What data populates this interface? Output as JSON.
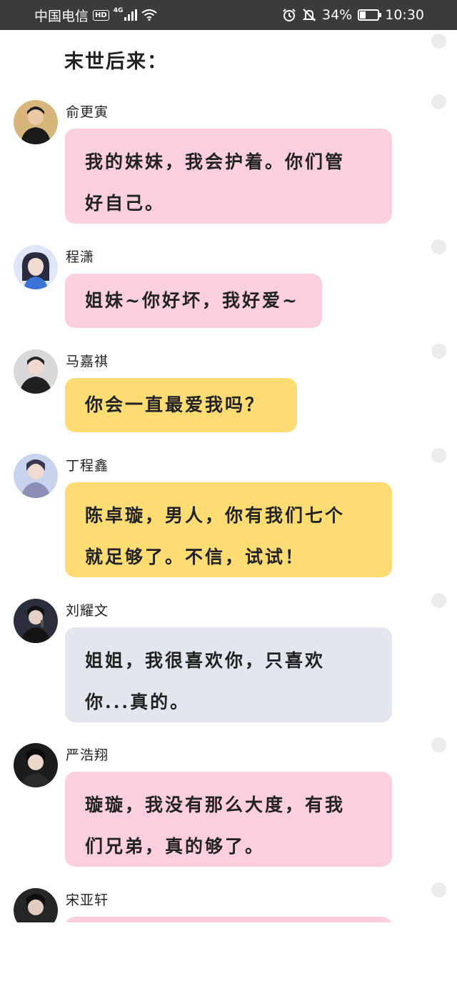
{
  "status_bar": {
    "carrier": "中国电信",
    "hd_badge": "HD",
    "network": "4G",
    "battery_percent": "34%",
    "battery_level": 0.34,
    "time": "10:30",
    "icons": [
      "signal-icon",
      "wifi-icon",
      "alarm-icon",
      "mute-bell-icon",
      "battery-icon"
    ]
  },
  "page": {
    "title": "末世后来："
  },
  "messages": [
    {
      "sender": "俞更寅",
      "text": "我的妹妹，我会护着。你们管\n好自己。",
      "bubble_color": "#fbd0dc"
    },
    {
      "sender": "程潇",
      "text": "姐妹~你好坏，我好爱~",
      "bubble_color": "#fbd0dc"
    },
    {
      "sender": "马嘉祺",
      "text": "你会一直最爱我吗？",
      "bubble_color": "#fedc74"
    },
    {
      "sender": "丁程鑫",
      "text": "陈卓璇，男人，你有我们七个\n就足够了。不信，试试！",
      "bubble_color": "#fedc74"
    },
    {
      "sender": "刘耀文",
      "text": "姐姐，我很喜欢你，只喜欢\n你...真的。",
      "bubble_color": "#e1e6ef"
    },
    {
      "sender": "严浩翔",
      "text": "璇璇，我没有那么大度，有我\n们兄弟，真的够了。",
      "bubble_color": "#fbd0dc"
    },
    {
      "sender": "宋亚轩",
      "text": "",
      "bubble_color": "#fbd0dc"
    }
  ]
}
